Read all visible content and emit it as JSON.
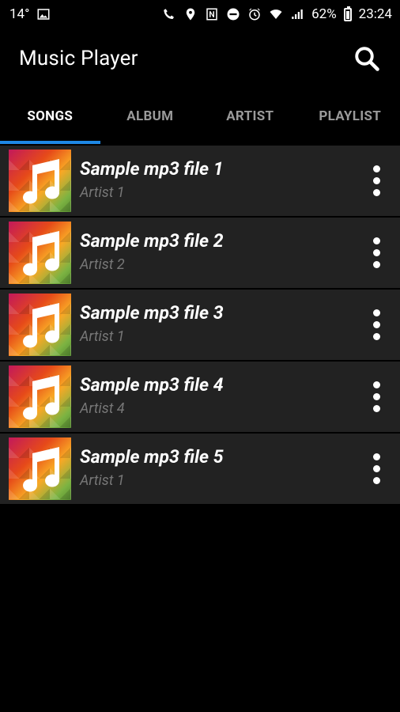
{
  "status_bar": {
    "temperature": "14°",
    "battery": "62%",
    "time": "23:24"
  },
  "app": {
    "title": "Music Player"
  },
  "tabs": [
    {
      "label": "SONGS",
      "active": true
    },
    {
      "label": "ALBUM",
      "active": false
    },
    {
      "label": "ARTIST",
      "active": false
    },
    {
      "label": "PLAYLIST",
      "active": false
    }
  ],
  "songs": [
    {
      "title": "Sample mp3 file 1",
      "artist": "Artist 1"
    },
    {
      "title": "Sample mp3 file 2",
      "artist": "Artist 2"
    },
    {
      "title": "Sample mp3 file 3",
      "artist": "Artist 1"
    },
    {
      "title": "Sample mp3 file 4",
      "artist": "Artist 4"
    },
    {
      "title": "Sample mp3 file 5",
      "artist": "Artist 1"
    }
  ],
  "colors": {
    "accent": "#1e88e5",
    "row_bg": "#222222",
    "background": "#000000"
  },
  "icons": [
    "image-icon",
    "wifi-call-icon",
    "location-icon",
    "nfc-icon",
    "dnd-icon",
    "alarm-icon",
    "wifi-icon",
    "signal-icon",
    "battery-icon",
    "search-icon",
    "music-note-icon",
    "more-vert-icon"
  ]
}
